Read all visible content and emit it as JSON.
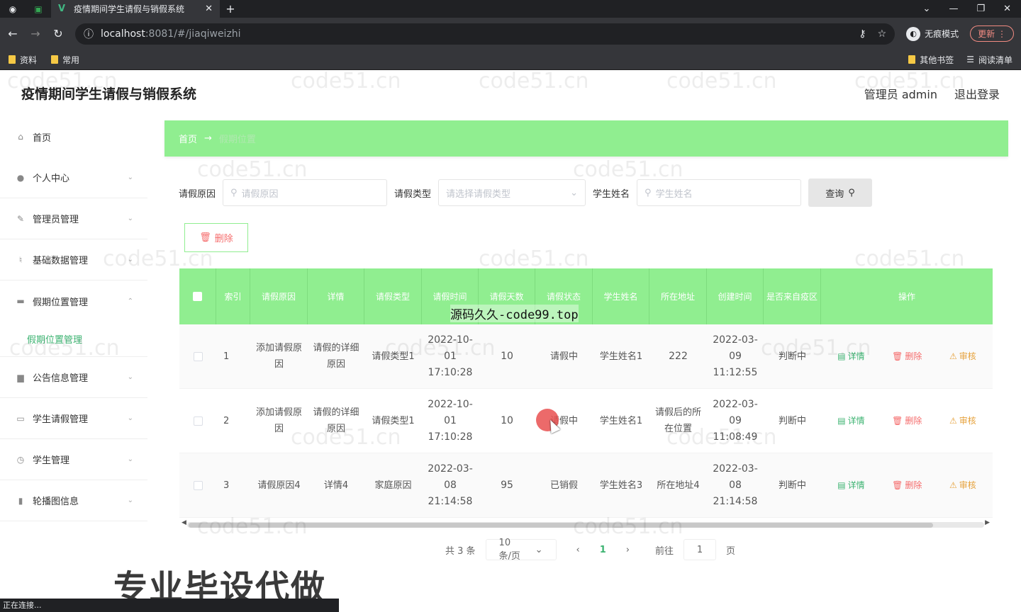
{
  "browser": {
    "tab_title": "疫情期间学生请假与销假系统",
    "url_host": "localhost",
    "url_path": ":8081/#/jiaqiweizhi",
    "incognito_label": "无痕模式",
    "update_label": "更新",
    "bookmarks": [
      "资料",
      "常用"
    ],
    "bookmarks_right": [
      "其他书签",
      "阅读清单"
    ],
    "status_text": "正在连接..."
  },
  "app": {
    "title": "疫情期间学生请假与销假系统",
    "user_label": "管理员 admin",
    "logout_label": "退出登录"
  },
  "sidebar": {
    "items": [
      {
        "label": "首页",
        "icon": "home-icon"
      },
      {
        "label": "个人中心",
        "icon": "user-icon"
      },
      {
        "label": "管理员管理",
        "icon": "edit-icon"
      },
      {
        "label": "基础数据管理",
        "icon": "mic-icon"
      },
      {
        "label": "假期位置管理",
        "icon": "chat-icon"
      },
      {
        "label": "公告信息管理",
        "icon": "board-icon"
      },
      {
        "label": "学生请假管理",
        "icon": "message-icon"
      },
      {
        "label": "学生管理",
        "icon": "clock-icon"
      },
      {
        "label": "轮播图信息",
        "icon": "chart-icon"
      }
    ],
    "active_sub": "假期位置管理"
  },
  "breadcrumb": {
    "home": "首页",
    "current": "假期位置"
  },
  "search": {
    "reason_label": "请假原因",
    "reason_placeholder": "请假原因",
    "type_label": "请假类型",
    "type_placeholder": "请选择请假类型",
    "name_label": "学生姓名",
    "name_placeholder": "学生姓名",
    "query_label": "查询"
  },
  "delete_label": "删除",
  "table": {
    "headers": [
      "索引",
      "请假原因",
      "详情",
      "请假类型",
      "请假时间",
      "请假天数",
      "请假状态",
      "学生姓名",
      "所在地址",
      "创建时间",
      "是否来自疫区",
      "操作"
    ],
    "rows": [
      {
        "index": "1",
        "reason": "添加请假原因",
        "detail": "请假的详细原因",
        "type": "请假类型1",
        "time": "2022-10-01 17:10:28",
        "days": "10",
        "status": "请假中",
        "name": "学生姓名1",
        "address": "222",
        "created": "2022-03-09 11:12:55",
        "epidemic": "判断中"
      },
      {
        "index": "2",
        "reason": "添加请假原因",
        "detail": "请假的详细原因",
        "type": "请假类型1",
        "time": "2022-10-01 17:10:28",
        "days": "10",
        "status": "请假中",
        "name": "学生姓名1",
        "address": "请假后的所在位置",
        "created": "2022-03-09 11:08:49",
        "epidemic": "判断中"
      },
      {
        "index": "3",
        "reason": "请假原因4",
        "detail": "详情4",
        "type": "家庭原因",
        "time": "2022-03-08 21:14:58",
        "days": "95",
        "status": "已销假",
        "name": "学生姓名3",
        "address": "所在地址4",
        "created": "2022-03-08 21:14:58",
        "epidemic": "判断中"
      }
    ],
    "ops": {
      "detail": "详情",
      "delete": "删除",
      "review": "审核"
    }
  },
  "pagination": {
    "total": "共 3 条",
    "page_size": "10条/页",
    "current": "1",
    "goto_label": "前往",
    "goto_value": "1",
    "page_unit": "页"
  },
  "overlay": {
    "brand": "源码久久-code99.top",
    "promo": "专业毕设代做",
    "watermark": "code51.cn"
  },
  "colors": {
    "accent": "#90ee90",
    "active_text": "#3cb371",
    "danger": "#f56c6c",
    "warning": "#e6a23c"
  }
}
